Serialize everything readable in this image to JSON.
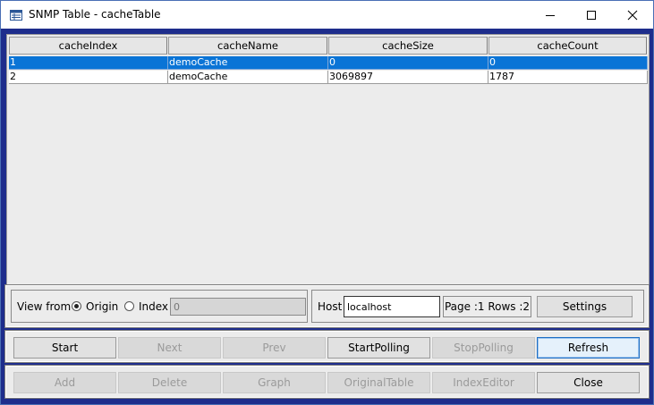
{
  "window": {
    "title": "SNMP Table - cacheTable"
  },
  "table": {
    "columns": [
      "cacheIndex",
      "cacheName",
      "cacheSize",
      "cacheCount"
    ],
    "rows": [
      [
        "1",
        "demoCache",
        "0",
        "0"
      ],
      [
        "2",
        "demoCache",
        "3069897",
        "1787"
      ]
    ],
    "selected_row": 0
  },
  "view": {
    "label": "View from",
    "origin_label": "Origin",
    "index_label": "Index",
    "selected": "Origin",
    "index_value": "0"
  },
  "host": {
    "label": "Host",
    "value": "localhost",
    "page_info": "Page :1 Rows :2",
    "settings_label": "Settings"
  },
  "nav_buttons": {
    "start": "Start",
    "next": "Next",
    "prev": "Prev",
    "start_polling": "StartPolling",
    "stop_polling": "StopPolling",
    "refresh": "Refresh"
  },
  "action_buttons": {
    "add": "Add",
    "delete": "Delete",
    "graph": "Graph",
    "original_table": "OriginalTable",
    "index_editor": "IndexEditor",
    "close": "Close"
  },
  "colors": {
    "selection": "#0a74d6",
    "frame": "#1e2d8c"
  },
  "icons": {
    "app": "table-window-icon",
    "minimize": "minimize-icon",
    "maximize": "maximize-icon",
    "close": "close-icon"
  }
}
